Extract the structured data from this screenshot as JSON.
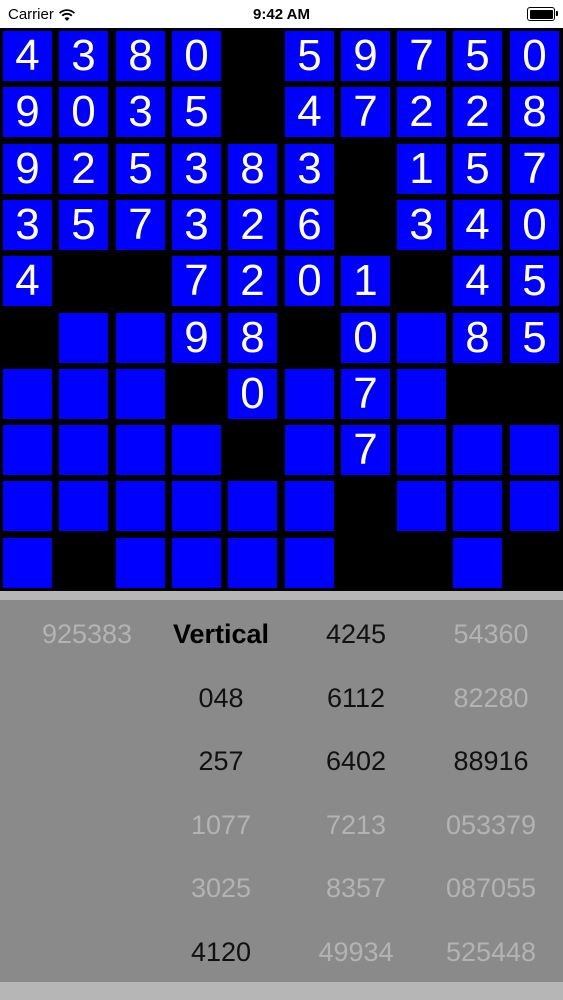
{
  "status_bar": {
    "carrier": "Carrier",
    "time": "9:42 AM",
    "wifi_icon": "wifi-icon",
    "battery_icon": "battery-icon"
  },
  "grid": {
    "cell_color": "#0000ff",
    "rows": [
      [
        "4",
        "3",
        "8",
        "0",
        null,
        "5",
        "9",
        "7",
        "5",
        "0"
      ],
      [
        "9",
        "0",
        "3",
        "5",
        null,
        "4",
        "7",
        "2",
        "2",
        "8"
      ],
      [
        "9",
        "2",
        "5",
        "3",
        "8",
        "3",
        null,
        "1",
        "5",
        "7"
      ],
      [
        "3",
        "5",
        "7",
        "3",
        "2",
        "6",
        null,
        "3",
        "4",
        "0"
      ],
      [
        "4",
        null,
        null,
        "7",
        "2",
        "0",
        "1",
        null,
        "4",
        "5"
      ],
      [
        null,
        "",
        "",
        "9",
        "8",
        null,
        "0",
        "",
        "8",
        "5"
      ],
      [
        "",
        "",
        "",
        null,
        "0",
        "",
        "7",
        "",
        null,
        null
      ],
      [
        "",
        "",
        "",
        "",
        null,
        "",
        "7",
        "",
        "",
        ""
      ],
      [
        "",
        "",
        "",
        "",
        "",
        "",
        null,
        "",
        "",
        ""
      ],
      [
        "",
        null,
        "",
        "",
        "",
        "",
        null,
        null,
        "",
        null
      ]
    ]
  },
  "picker": {
    "columns": [
      [
        "925383",
        "",
        "",
        "",
        "",
        ""
      ],
      [
        "Vertical",
        "048",
        "257",
        "1077",
        "3025",
        "4120"
      ],
      [
        "4245",
        "6112",
        "6402",
        "7213",
        "8357",
        "49934"
      ],
      [
        "54360",
        "82280",
        "88916",
        "053379",
        "087055",
        "525448"
      ]
    ]
  }
}
